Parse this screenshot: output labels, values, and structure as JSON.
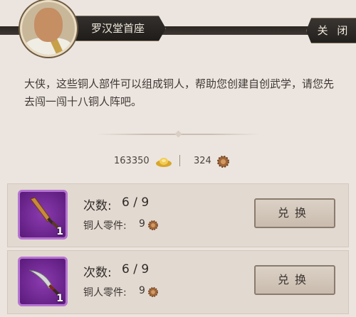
{
  "npc": {
    "name": "罗汉堂首座",
    "close_label": "关 闭"
  },
  "dialog": {
    "text": "大侠，这些铜人部件可以组成铜人，帮助您创建自创武学，请您先去闯一闯十八铜人阵吧。"
  },
  "currency": {
    "silver": "163350",
    "parts": "324"
  },
  "items": [
    {
      "count": "1",
      "uses_label": "次数:",
      "uses_value": "6 / 9",
      "cost_label": "铜人零件:",
      "cost_value": "9",
      "button_label": "兑换"
    },
    {
      "count": "1",
      "uses_label": "次数:",
      "uses_value": "6 / 9",
      "cost_label": "铜人零件:",
      "cost_value": "9",
      "button_label": "兑换"
    }
  ],
  "icons": {
    "currency_silver": "gold-ingot-icon",
    "currency_parts": "bronze-gear-icon",
    "item1": "dagger-icon",
    "item2": "curved-blade-icon"
  },
  "colors": {
    "item_slot": "#8b3bb0",
    "header_plate": "#2b2623",
    "background": "#ece5df"
  }
}
